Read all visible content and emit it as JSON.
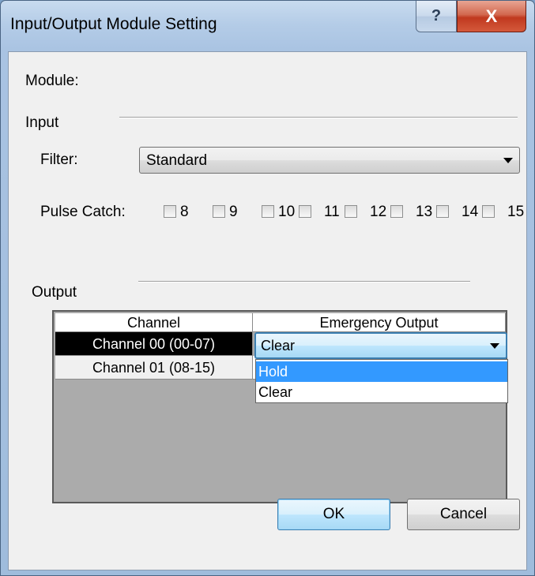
{
  "window": {
    "title": "Input/Output Module Setting",
    "help_glyph": "?",
    "close_glyph": "X"
  },
  "module": {
    "label": "Module:"
  },
  "input": {
    "section_label": "Input",
    "filter_label": "Filter:",
    "filter_value": "Standard",
    "pulse_catch_label": "Pulse Catch:",
    "pulse_catch": [
      {
        "label": "8",
        "checked": false
      },
      {
        "label": "9",
        "checked": false
      },
      {
        "label": "10",
        "checked": false
      },
      {
        "label": "11",
        "checked": false
      },
      {
        "label": "12",
        "checked": false
      },
      {
        "label": "13",
        "checked": false
      },
      {
        "label": "14",
        "checked": false
      },
      {
        "label": "15",
        "checked": false
      }
    ]
  },
  "output": {
    "section_label": "Output",
    "columns": [
      "Channel",
      "Emergency Output"
    ],
    "rows": [
      {
        "channel": "Channel 00 (00-07)",
        "emergency_output": "Clear"
      },
      {
        "channel": "Channel 01 (08-15)",
        "emergency_output": ""
      }
    ],
    "dropdown_options": [
      "Hold",
      "Clear"
    ],
    "dropdown_highlighted": "Hold"
  },
  "buttons": {
    "ok": "OK",
    "cancel": "Cancel"
  }
}
